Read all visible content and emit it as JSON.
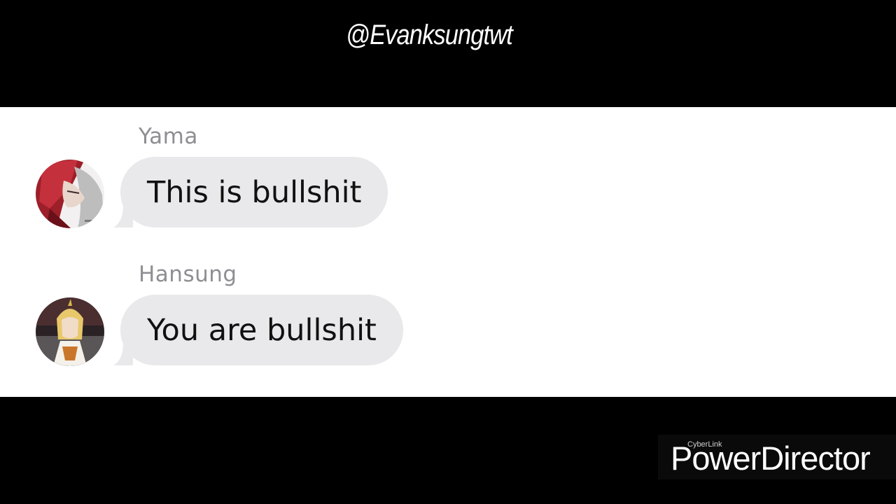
{
  "watermark": {
    "handle": "@Evanksungtwt"
  },
  "messages": [
    {
      "sender": "Yama",
      "text": "This is bullshit",
      "avatar_icon": "anime-character-red-hair-avatar"
    },
    {
      "sender": "Hansung",
      "text": "You are bullshit",
      "avatar_icon": "anime-character-blonde-avatar"
    }
  ],
  "editor_watermark": {
    "brand": "CyberLink",
    "product": "PowerDirector"
  },
  "colors": {
    "background": "#000000",
    "chat_background": "#ffffff",
    "bubble": "#e9e9eb",
    "sender_name": "#8e8e93",
    "message_text": "#111111"
  }
}
